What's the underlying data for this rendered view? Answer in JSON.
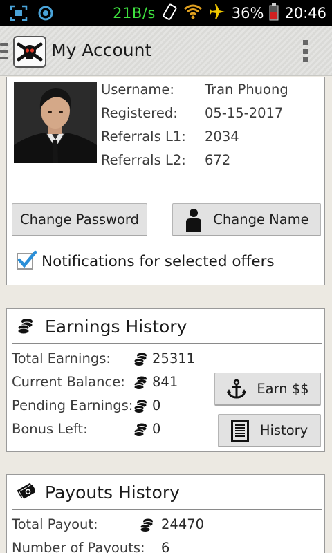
{
  "status_bar": {
    "net_speed": "21B/s",
    "battery_percent": "36%",
    "time": "20:46"
  },
  "action_bar": {
    "title": "My Account"
  },
  "profile": {
    "rows": [
      {
        "label": "Username:",
        "value": "Tran Phuong"
      },
      {
        "label": "Registered:",
        "value": "05-15-2017"
      },
      {
        "label": "Referrals L1:",
        "value": "2034"
      },
      {
        "label": "Referrals L2:",
        "value": "672"
      }
    ],
    "change_password_label": "Change Password",
    "change_name_label": "Change Name",
    "notifications_label": "Notifications for selected offers",
    "notifications_checked": true
  },
  "earnings": {
    "title": "Earnings History",
    "rows": [
      {
        "label": "Total Earnings:",
        "value": "25311"
      },
      {
        "label": "Current Balance:",
        "value": "841"
      },
      {
        "label": "Pending Earnings:",
        "value": "0"
      },
      {
        "label": "Bonus Left:",
        "value": "0"
      }
    ],
    "earn_button_label": "Earn $$",
    "history_button_label": "History"
  },
  "payouts": {
    "title": "Payouts History",
    "rows": [
      {
        "label": "Total Payout:",
        "value": "24470"
      },
      {
        "label": "Number of Payouts:",
        "value": "6"
      }
    ]
  },
  "colors": {
    "status_speed": "#3fe13f",
    "checkbox_check": "#2a8fd8",
    "card_border": "#9a9a9a"
  }
}
